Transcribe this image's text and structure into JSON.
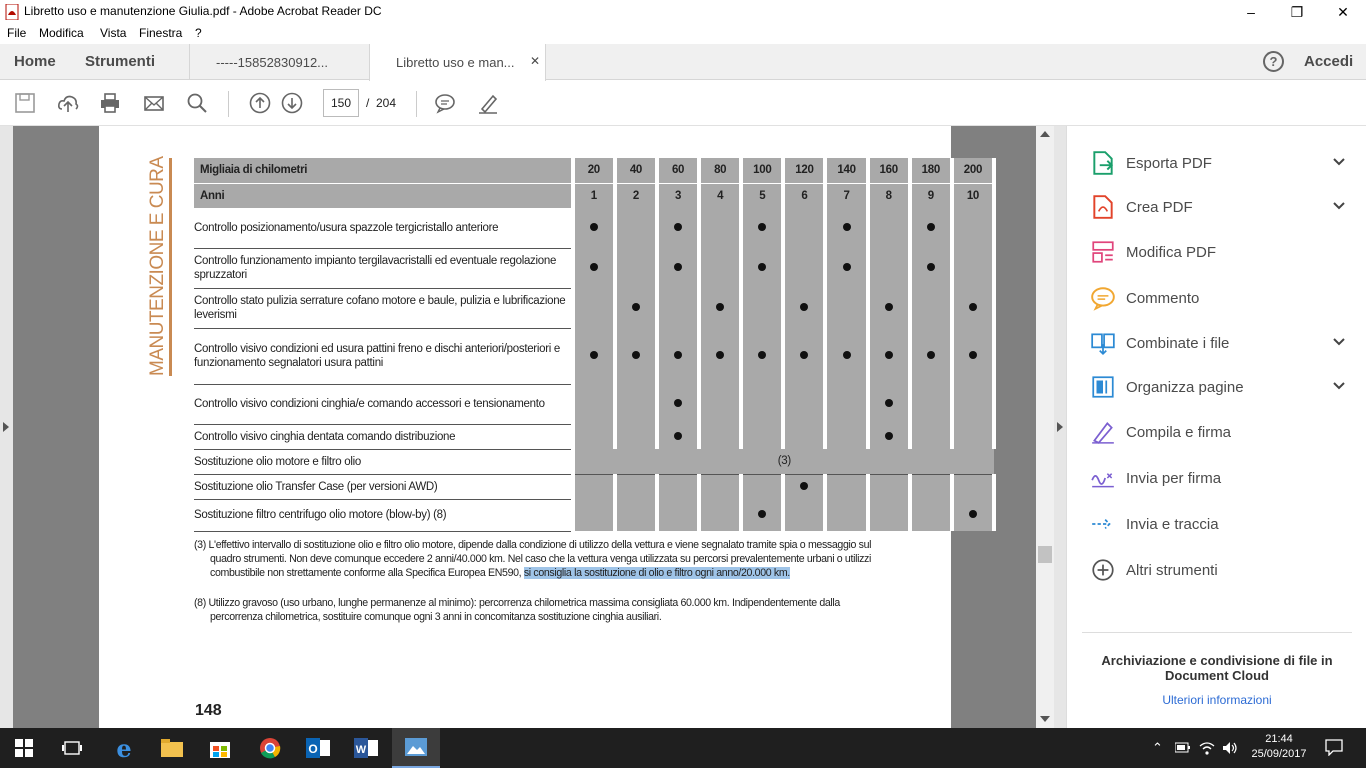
{
  "window": {
    "title": "Libretto uso e manutenzione Giulia.pdf - Adobe Acrobat Reader DC"
  },
  "menu": [
    "File",
    "Modifica",
    "Vista",
    "Finestra",
    "?"
  ],
  "tabs": {
    "home": "Home",
    "tools": "Strumenti",
    "doc1": "-----15852830912...",
    "doc2": "Libretto uso e man...",
    "help": "?",
    "signin": "Accedi"
  },
  "toolbar": {
    "page_current": "150",
    "page_sep": "/",
    "page_total": "204"
  },
  "document": {
    "side_title": "MANUTENZIONE E CURA",
    "header_label1": "Migliaia di chilometri",
    "header_label2": "Anni",
    "km": [
      "20",
      "40",
      "60",
      "80",
      "100",
      "120",
      "140",
      "160",
      "180",
      "200"
    ],
    "years": [
      "1",
      "2",
      "3",
      "4",
      "5",
      "6",
      "7",
      "8",
      "9",
      "10"
    ],
    "rows": [
      {
        "text": "Controllo posizionamento/usura spazzole tergicristallo anteriore",
        "dots": [
          1,
          0,
          1,
          0,
          1,
          0,
          1,
          0,
          1,
          0
        ]
      },
      {
        "text": "Controllo funzionamento impianto tergilavacristalli ed eventuale regolazione spruzzatori",
        "dots": [
          1,
          0,
          1,
          0,
          1,
          0,
          1,
          0,
          1,
          0
        ]
      },
      {
        "text": "Controllo stato pulizia serrature cofano motore e baule, pulizia e lubrificazione leverismi",
        "dots": [
          0,
          1,
          0,
          1,
          0,
          1,
          0,
          1,
          0,
          1
        ]
      },
      {
        "text": "Controllo visivo condizioni ed usura pattini freno e dischi anteriori/posteriori e funzionamento segnalatori usura pattini",
        "dots": [
          1,
          1,
          1,
          1,
          1,
          1,
          1,
          1,
          1,
          1
        ]
      },
      {
        "text": "Controllo visivo condizioni cinghia/e comando accessori e tensionamento",
        "dots": [
          0,
          0,
          1,
          0,
          0,
          0,
          0,
          1,
          0,
          0
        ]
      },
      {
        "text": "Controllo visivo cinghia dentata comando distribuzione",
        "dots": [
          0,
          0,
          1,
          0,
          0,
          0,
          0,
          1,
          0,
          0
        ]
      },
      {
        "text": "Sostituzione olio motore e filtro olio",
        "note": "(3)"
      },
      {
        "text": "Sostituzione olio Transfer Case (per versioni AWD)",
        "dots": [
          0,
          0,
          0,
          0,
          0,
          1,
          0,
          0,
          0,
          0
        ]
      },
      {
        "text": "Sostituzione filtro centrifugo olio motore (blow-by) (8)",
        "dots": [
          0,
          0,
          0,
          0,
          1,
          0,
          0,
          0,
          0,
          1
        ]
      }
    ],
    "footnote3_a": "(3) L'effettivo intervallo di sostituzione olio e filtro olio motore, dipende dalla condizione di utilizzo della vettura e viene segnalato tramite spia o messaggio sul quadro strumenti. Non deve comunque eccedere 2 anni/40.000 km. Nel caso che la vettura venga utilizzata su percorsi prevalentemente urbani o utilizzi combustibile non strettamente conforme alla Specifica Europea EN590, ",
    "footnote3_hl": "si consiglia la sostituzione di olio e filtro ogni anno/20.000 km.",
    "footnote8": "(8) Utilizzo gravoso (uso urbano, lunghe permanenze al minimo): percorrenza chilometrica massima consigliata 60.000 km. Indipendentemente dalla percorrenza chilometrica, sostituire comunque ogni 3 anni in concomitanza sostituzione cinghia ausiliari.",
    "page_number": "148"
  },
  "tools": [
    {
      "label": "Esporta PDF",
      "icon": "export-pdf-icon",
      "color": "#1a9f6b",
      "chevron": true
    },
    {
      "label": "Crea PDF",
      "icon": "create-pdf-icon",
      "color": "#e2432a",
      "chevron": true
    },
    {
      "label": "Modifica PDF",
      "icon": "edit-pdf-icon",
      "color": "#e0457b",
      "chevron": false
    },
    {
      "label": "Commento",
      "icon": "comment-icon",
      "color": "#f1a731",
      "chevron": false
    },
    {
      "label": "Combinate i file",
      "icon": "combine-files-icon",
      "color": "#2c8ad4",
      "chevron": true
    },
    {
      "label": "Organizza pagine",
      "icon": "organize-pages-icon",
      "color": "#2c8ad4",
      "chevron": true
    },
    {
      "label": "Compila e firma",
      "icon": "fill-sign-icon",
      "color": "#7b5fd1",
      "chevron": false
    },
    {
      "label": "Invia per firma",
      "icon": "send-sign-icon",
      "color": "#7b5fd1",
      "chevron": false
    },
    {
      "label": "Invia e traccia",
      "icon": "send-track-icon",
      "color": "#2c8ad4",
      "chevron": false
    },
    {
      "label": "Altri strumenti",
      "icon": "more-tools-icon",
      "color": "#555555",
      "chevron": false
    }
  ],
  "cloud": {
    "text": "Archiviazione e condivisione di file in Document Cloud",
    "link": "Ulteriori informazioni"
  },
  "clock": {
    "time": "21:44",
    "date": "25/09/2017"
  }
}
